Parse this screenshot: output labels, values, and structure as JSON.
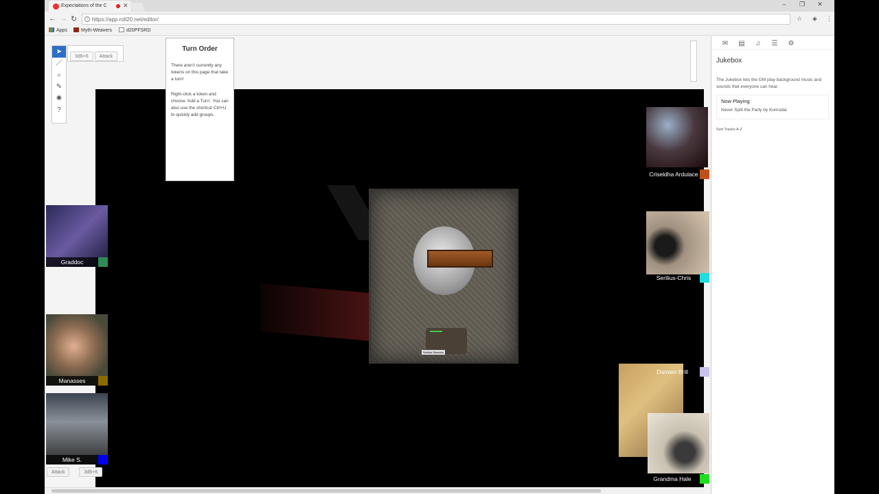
{
  "browser": {
    "tab_title": "Expectations of the C",
    "url": "https://app.roll20.net/editor/",
    "bookmarks": [
      "Apps",
      "Myth-Weavers",
      "d20PFSRD"
    ]
  },
  "toolbar": {
    "macros": [
      "3d6+6",
      "Attack"
    ]
  },
  "turn_order": {
    "title": "Turn Order",
    "line1": "There aren't currently any tokens on this page that take a turn!",
    "line2": "Right-click a token and choose 'Add a Turn'. You can also use the shortcut Ctrl+U to quickly add groups."
  },
  "players_left": [
    {
      "name": "Graddoc",
      "color": "#2e8b57"
    },
    {
      "name": "Manasses",
      "color": "#8b6a00"
    },
    {
      "name": "Mike S.",
      "color": "#0000ee"
    }
  ],
  "players_right": [
    {
      "name": "Criseldha Ardulace",
      "color": "#c0501a"
    },
    {
      "name": "Serilius-Chris",
      "color": "#22dddd"
    },
    {
      "name": "Damien Brill",
      "color": "#c8c0ee"
    },
    {
      "name": "Grandma Hale",
      "color": "#22dd22"
    }
  ],
  "bottom_macros": [
    "Attack",
    "3d6+6"
  ],
  "token": {
    "label": "Serilius Shaesbo"
  },
  "jukebox": {
    "title": "Jukebox",
    "description": "The Jukebox lets the GM play background music and sounds that everyone can hear.",
    "now_playing_label": "Now Playing",
    "track": "Never Split the Party by Komodai",
    "sort_link": "Sort Tracks A-Z"
  }
}
